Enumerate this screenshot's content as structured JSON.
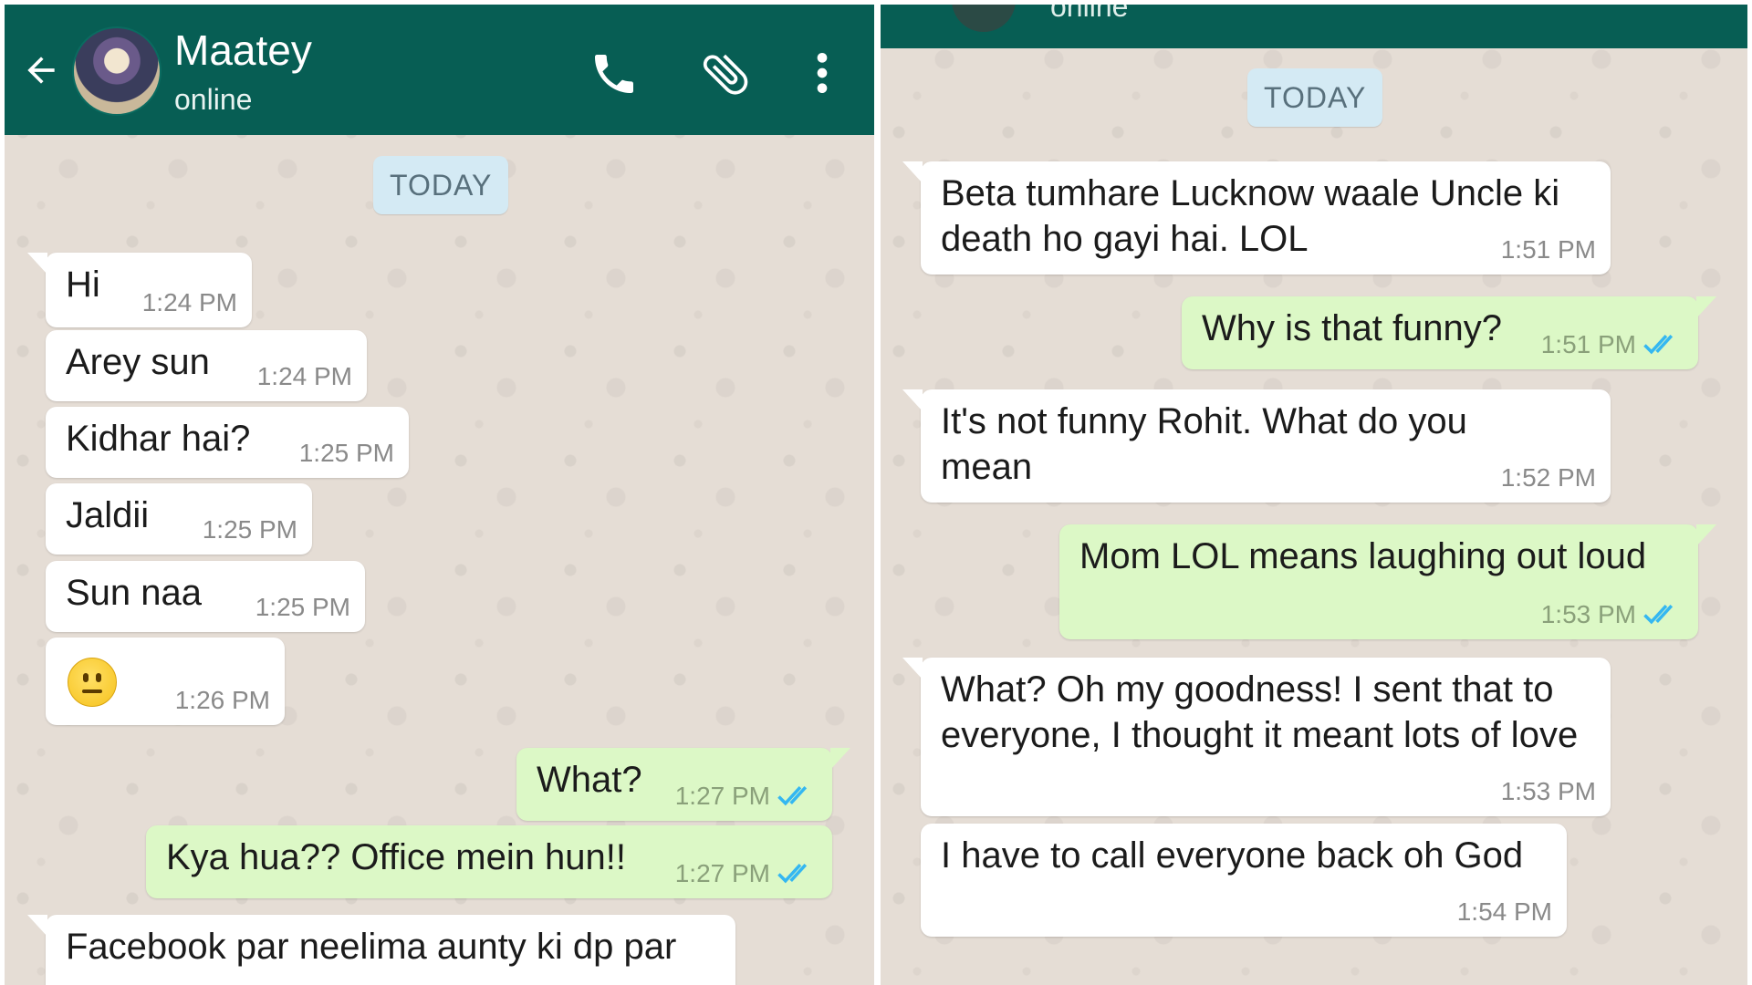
{
  "left_chat": {
    "contact_name": "Maatey",
    "contact_status": "online",
    "date_label": "TODAY",
    "messages": [
      {
        "text": "Hi",
        "time": "1:24 PM"
      },
      {
        "text": "Arey sun",
        "time": "1:24 PM"
      },
      {
        "text": "Kidhar hai?",
        "time": "1:25 PM"
      },
      {
        "text": "Jaldii",
        "time": "1:25 PM"
      },
      {
        "text": "Sun naa",
        "time": "1:25 PM"
      },
      {
        "text": "",
        "time": "1:26 PM",
        "emoji": "neutral-face"
      },
      {
        "text": "What?",
        "time": "1:27 PM"
      },
      {
        "text": "Kya hua?? Office mein hun!!",
        "time": "1:27 PM"
      },
      {
        "text": "Facebook par neelima aunty ki dp par"
      }
    ]
  },
  "right_chat": {
    "contact_status": "online",
    "date_label": "TODAY",
    "messages": [
      {
        "text": "Beta tumhare Lucknow waale Uncle ki death ho gayi hai. LOL",
        "time": "1:51 PM"
      },
      {
        "text": "Why is that funny?",
        "time": "1:51 PM"
      },
      {
        "text": "It's not funny Rohit. What do you mean",
        "time": "1:52 PM"
      },
      {
        "text": "Mom LOL means laughing out loud",
        "time": "1:53 PM"
      },
      {
        "text": "What? Oh my goodness! I sent that to everyone, I thought it meant lots of love",
        "time": "1:53 PM"
      },
      {
        "text": "I have to call everyone back oh God",
        "time": "1:54 PM"
      }
    ]
  },
  "colors": {
    "header": "#075e54",
    "incoming_bubble": "#ffffff",
    "outgoing_bubble": "#dcf8c6",
    "read_ticks": "#34b7f1",
    "chat_background": "#e5ddd5"
  },
  "icons": [
    "back-arrow-icon",
    "phone-icon",
    "paperclip-icon",
    "more-vert-icon",
    "double-check-icon",
    "neutral-face-emoji"
  ]
}
